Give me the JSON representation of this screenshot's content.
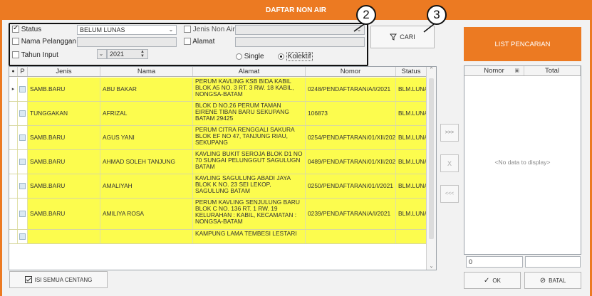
{
  "window": {
    "title": "DAFTAR NON AIR"
  },
  "filters": {
    "status": {
      "label": "Status",
      "checked": true,
      "value": "BELUM LUNAS"
    },
    "jenis_non_air": {
      "label": "Jenis Non Air",
      "checked": false,
      "value": ""
    },
    "nama_pelanggan": {
      "label": "Nama Pelanggan",
      "checked": false,
      "value": ""
    },
    "alamat": {
      "label": "Alamat",
      "checked": false,
      "value": ""
    },
    "tahun_input": {
      "label": "Tahun Input",
      "checked": false,
      "month": "",
      "year": "2021"
    },
    "mode": {
      "single_label": "Single",
      "kolektif_label": "Kolektif",
      "selected": "Kolektif"
    }
  },
  "actions": {
    "cari_label": "CARI",
    "isi_semua_centang_label": "ISI SEMUA CENTANG",
    "move_right": ">>>",
    "remove": "X",
    "move_left": "<<<",
    "ok_label": "OK",
    "batal_label": "BATAL"
  },
  "callouts": {
    "c2": "2",
    "c3": "3"
  },
  "grid": {
    "columns": {
      "p": "P",
      "jenis": "Jenis",
      "nama": "Nama",
      "alamat": "Alamat",
      "nomor": "Nomor",
      "status": "Status"
    },
    "rows": [
      {
        "jenis": "SAMB.BARU",
        "nama": "ABU BAKAR",
        "alamat": "PERUM KAVLING KSB BIDA KABIL BLOK A5 NO. 3 RT. 3 RW. 18 KABIL, NONGSA-BATAM",
        "nomor": "0248/PENDAFTARAN/A/I/2021",
        "status": "BLM.LUNAS"
      },
      {
        "jenis": "TUNGGAKAN",
        "nama": "AFRIZAL",
        "alamat": "BLOK D NO.26 PERUM TAMAN EIRENE TIBAN BARU SEKUPANG BATAM 29425",
        "nomor": "106873",
        "status": "BLM.LUNAS"
      },
      {
        "jenis": "SAMB.BARU",
        "nama": "AGUS YANI",
        "alamat": "PERUM CITRA RENGGALI SAKURA BLOK EF NO 47, TANJUNG RIAU, SEKUPANG",
        "nomor": "0254/PENDAFTARAN/01/XII/2020",
        "status": "BLM.LUNAS"
      },
      {
        "jenis": "SAMB.BARU",
        "nama": "AHMAD SOLEH TANJUNG",
        "alamat": "KAVLING BUKIT SEROJA BLOK D1 NO 70 SUNGAI PELUNGGUT SAGULUGN BATAM",
        "nomor": "0489/PENDAFTARAN/01/XII/2020",
        "status": "BLM.LUNAS"
      },
      {
        "jenis": "SAMB.BARU",
        "nama": "AMALIYAH",
        "alamat": "KAVLING SAGULUNG ABADI JAYA BLOK K NO. 23 SEI LEKOP, SAGULUNG BATAM",
        "nomor": "0250/PENDAFTARAN/01/I/2021",
        "status": "BLM.LUNAS"
      },
      {
        "jenis": "SAMB.BARU",
        "nama": "AMILIYA ROSA",
        "alamat": "PERUM KAVLING SENJULUNG BARU BLOK C NO. 136 RT. 1 RW. 19 KELURAHAN : KABIL, KECAMATAN : NONGSA-BATAM",
        "nomor": "0239/PENDAFTARAN/A/I/2021",
        "status": "BLM.LUNAS"
      },
      {
        "jenis": "",
        "nama": "",
        "alamat": "KAMPUNG LAMA TEMBESI LESTARI",
        "nomor": "",
        "status": ""
      }
    ]
  },
  "list_pencarian": {
    "title": "LIST PENCARIAN",
    "columns": {
      "nomor": "Nomor",
      "total": "Total"
    },
    "empty_text": "<No data to display>",
    "footer_value": "0"
  }
}
